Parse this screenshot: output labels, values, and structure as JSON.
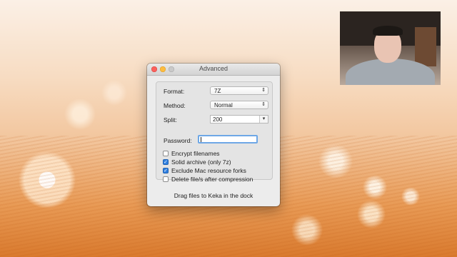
{
  "window": {
    "title": "Advanced"
  },
  "form": {
    "format_label": "Format:",
    "format_value": "7Z",
    "method_label": "Method:",
    "method_value": "Normal",
    "split_label": "Split:",
    "split_value": "200",
    "password_label": "Password:",
    "password_value": ""
  },
  "options": [
    {
      "label": "Encrypt filenames",
      "checked": false
    },
    {
      "label": "Solid archive (only 7z)",
      "checked": true
    },
    {
      "label": "Exclude Mac resource forks",
      "checked": true
    },
    {
      "label": "Delete file/s after compression",
      "checked": false
    }
  ],
  "footer": {
    "hint": "Drag files to Keka in the dock"
  },
  "icons": {
    "popup_arrow": "updown-arrows-icon",
    "combo_arrow": "chevron-down-icon",
    "checkmark": "checkmark-icon"
  },
  "colors": {
    "accent": "#2f7fe0",
    "close": "#fc605c",
    "minimize": "#fdbc40",
    "maximize": "#c9c9c9"
  }
}
